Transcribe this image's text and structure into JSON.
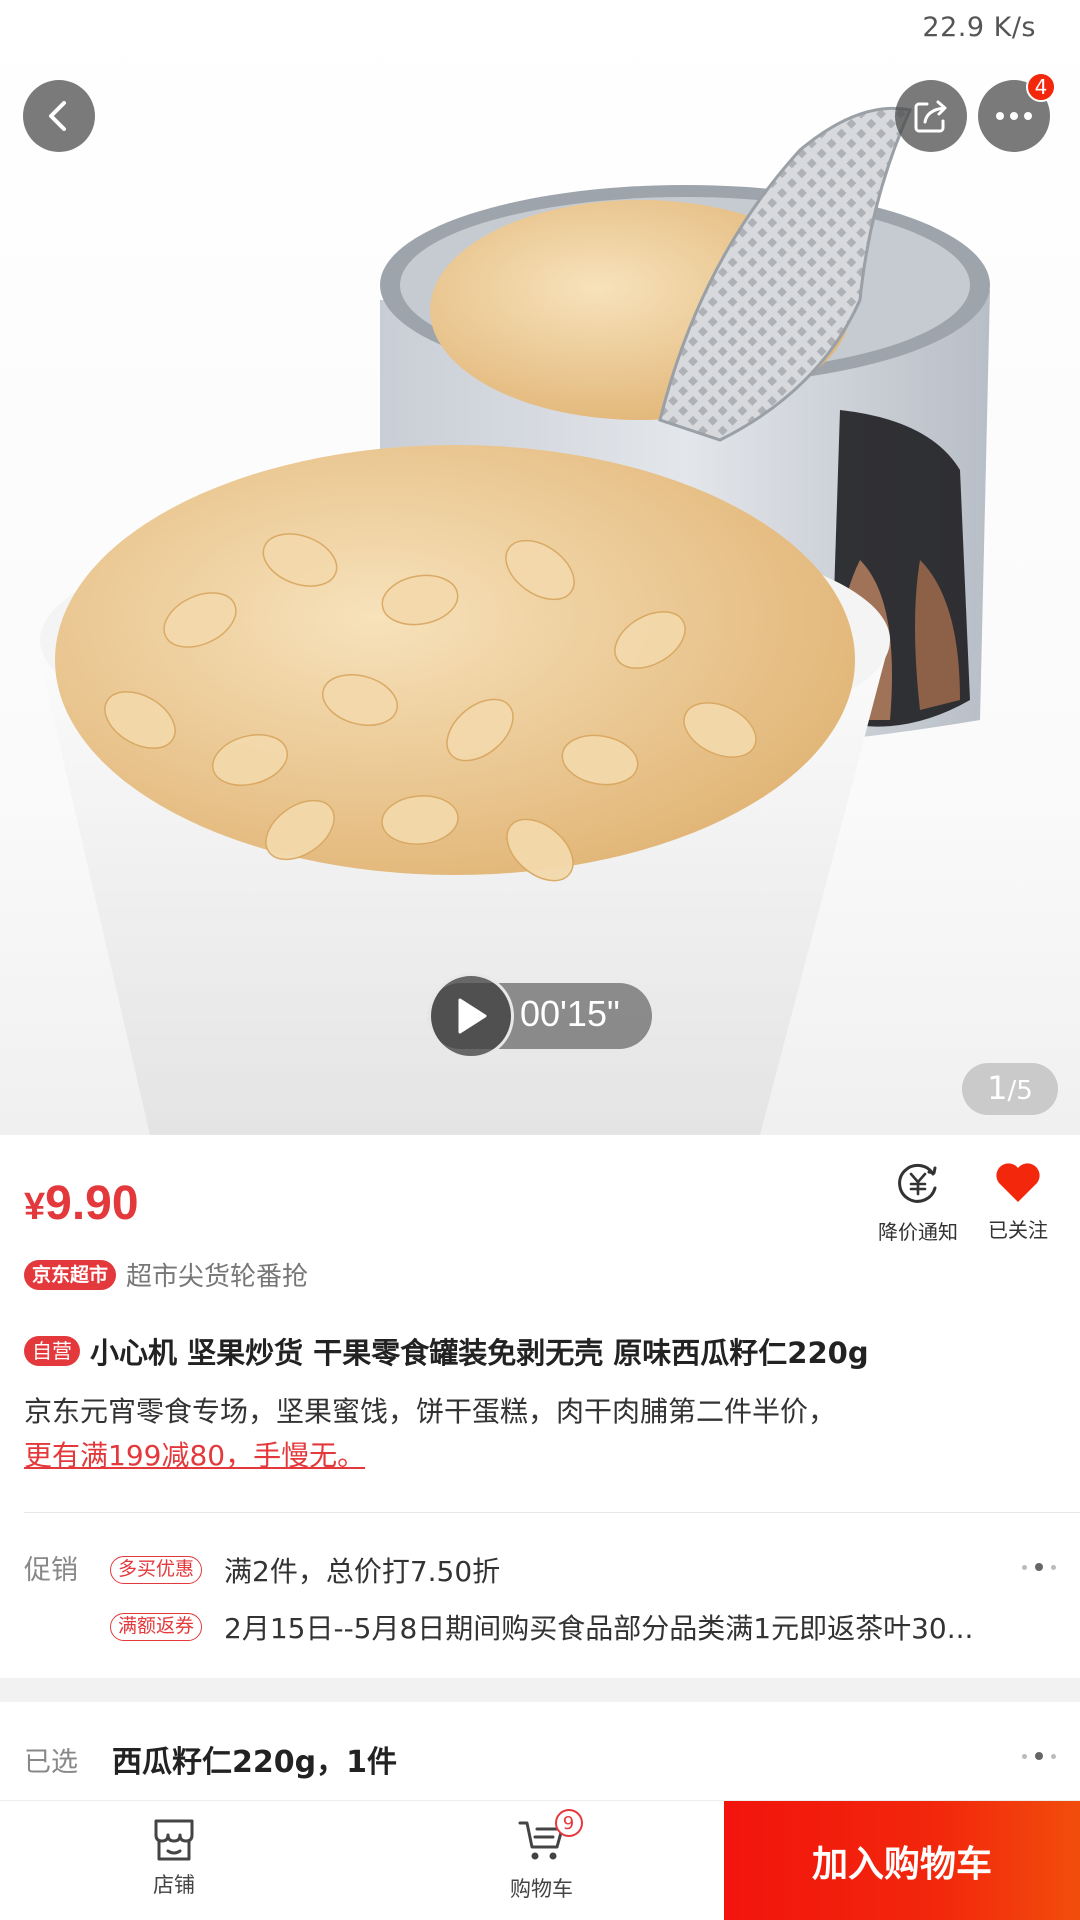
{
  "status": {
    "network_speed": "22.9 K/s"
  },
  "header": {
    "more_badge": "4"
  },
  "video": {
    "duration": "00'15\""
  },
  "gallery": {
    "current": "1",
    "separator": "/",
    "total": "5"
  },
  "product": {
    "price_symbol": "¥",
    "price": "9.90",
    "actions": {
      "price_alert": "降价通知",
      "follow": "已关注"
    },
    "store_tag": "京东超市",
    "store_slogan": "超市尖货轮番抢",
    "self_tag": "自营",
    "title": "小心机 坚果炒货 干果零食罐装免剥无壳 原味西瓜籽仁220g",
    "description": "京东元宵零食专场，坚果蜜饯，饼干蛋糕，肉干肉脯第二件半价，",
    "description_link": "更有满199减80，手慢无。"
  },
  "promotion": {
    "label": "促销",
    "items": [
      {
        "tag": "多买优惠",
        "text": "满2件，总价打7.50折"
      },
      {
        "tag": "满额返券",
        "text": "2月15日--5月8日期间购买食品部分品类满1元即返茶叶30..."
      }
    ]
  },
  "selection": {
    "label": "已选",
    "value": "西瓜籽仁220g，1件"
  },
  "bottom_bar": {
    "store_label": "店铺",
    "cart_label": "购物车",
    "cart_badge": "9",
    "add_to_cart": "加入购物车"
  },
  "colors": {
    "accent": "#e4393c",
    "cta": "#f2270c"
  }
}
